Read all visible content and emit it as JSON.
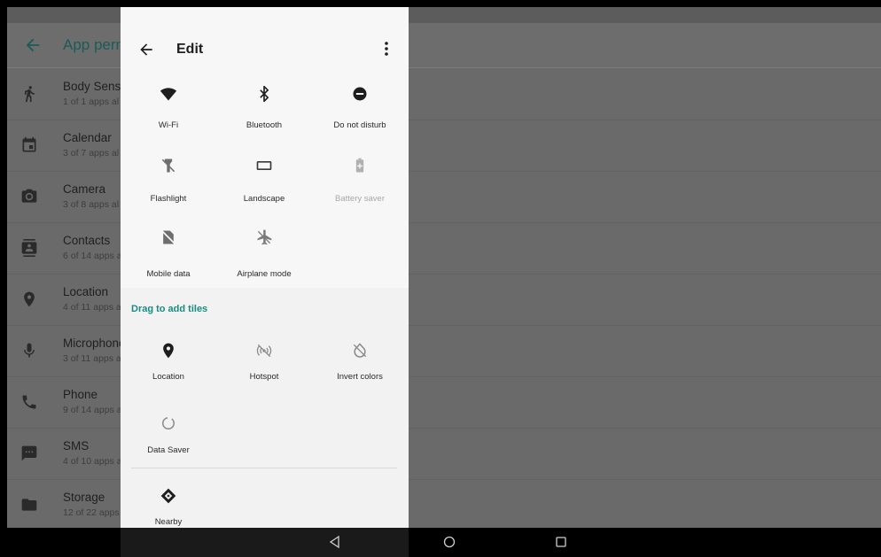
{
  "background": {
    "app_bar_title": "App perm",
    "permissions": [
      {
        "name": "Body Senso",
        "sub": "1 of 1 apps al",
        "icon": "body-sensor-icon"
      },
      {
        "name": "Calendar",
        "sub": "3 of 7 apps al",
        "icon": "calendar-icon"
      },
      {
        "name": "Camera",
        "sub": "3 of 8 apps al",
        "icon": "camera-icon"
      },
      {
        "name": "Contacts",
        "sub": "6 of 14 apps a",
        "icon": "contacts-icon"
      },
      {
        "name": "Location",
        "sub": "4 of 11 apps a",
        "icon": "location-icon"
      },
      {
        "name": "Microphone",
        "sub": "3 of 11 apps a",
        "icon": "microphone-icon"
      },
      {
        "name": "Phone",
        "sub": "9 of 14 apps a",
        "icon": "phone-icon"
      },
      {
        "name": "SMS",
        "sub": "4 of 10 apps a",
        "icon": "sms-icon"
      },
      {
        "name": "Storage",
        "sub": "12 of 22 apps",
        "icon": "folder-icon"
      }
    ]
  },
  "edit": {
    "title": "Edit",
    "active_tiles": [
      {
        "label": "Wi-Fi",
        "icon": "wifi-icon"
      },
      {
        "label": "Bluetooth",
        "icon": "bluetooth-icon"
      },
      {
        "label": "Do not disturb",
        "icon": "do-not-disturb-icon"
      },
      {
        "label": "Flashlight",
        "icon": "flashlight-icon"
      },
      {
        "label": "Landscape",
        "icon": "landscape-icon"
      },
      {
        "label": "Battery saver",
        "icon": "battery-saver-icon"
      },
      {
        "label": "Mobile data",
        "icon": "mobile-data-icon"
      },
      {
        "label": "Airplane mode",
        "icon": "airplane-icon"
      }
    ],
    "drag_label": "Drag to add tiles",
    "available_tiles": [
      {
        "label": "Location",
        "icon": "location-icon"
      },
      {
        "label": "Hotspot",
        "icon": "hotspot-icon"
      },
      {
        "label": "Invert colors",
        "icon": "invert-colors-icon"
      },
      {
        "label": "Data Saver",
        "icon": "data-saver-icon"
      }
    ],
    "other_tiles": [
      {
        "label": "Nearby",
        "icon": "nearby-icon"
      }
    ]
  },
  "navbar": {
    "buttons": [
      "back-icon",
      "home-icon",
      "recents-icon"
    ]
  },
  "colors": {
    "accent": "#1a8b80",
    "panel": "#f2f2f2",
    "dim_overlay": "#6a6a6a"
  }
}
